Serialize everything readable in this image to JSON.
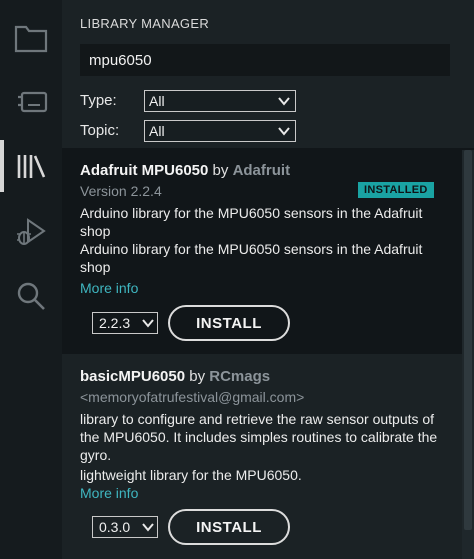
{
  "activity_bar": {
    "items": [
      {
        "icon": "folder-icon"
      },
      {
        "icon": "board-icon"
      },
      {
        "icon": "library-icon",
        "active": true
      },
      {
        "icon": "debug-icon"
      },
      {
        "icon": "search-icon"
      }
    ]
  },
  "library_manager": {
    "title": "LIBRARY MANAGER",
    "search_value": "mpu6050",
    "type_label": "Type:",
    "type_value": "All",
    "topic_label": "Topic:",
    "topic_value": "All"
  },
  "libraries": [
    {
      "name": "Adafruit MPU6050",
      "by": "by",
      "author": "Adafruit",
      "version_text": "Version 2.2.4",
      "badge": "INSTALLED",
      "description_1": "Arduino library for the MPU6050 sensors in the Adafruit shop",
      "description_2": "Arduino library for the MPU6050 sensors in the Adafruit shop",
      "more_info": "More info",
      "selected_version": "2.2.3",
      "install_label": "INSTALL"
    },
    {
      "name": "basicMPU6050",
      "by": "by",
      "author": "RCmags",
      "email": "<memoryofatrufestival@gmail.com>",
      "description_1": "library to configure and retrieve the raw sensor outputs of the MPU6050. It includes simples routines to calibrate the gyro.",
      "description_2": "lightweight library for the MPU6050.",
      "more_info": "More info",
      "selected_version": "0.3.0",
      "install_label": "INSTALL"
    }
  ],
  "colors": {
    "accent": "#1aa3a3",
    "link": "#3fb6c0",
    "background": "#1b2225"
  }
}
